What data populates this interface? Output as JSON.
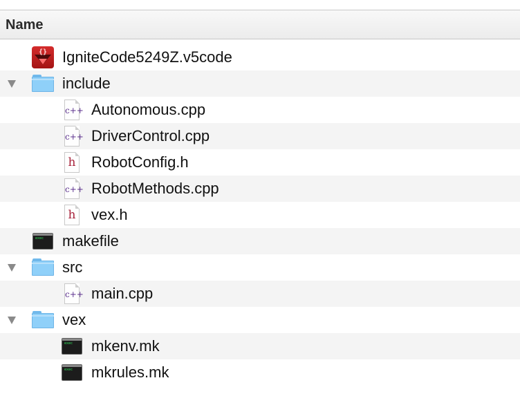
{
  "column_header": {
    "name_label": "Name"
  },
  "rows": [
    {
      "name": "IgniteCode5249Z.v5code",
      "icon": "v5code-file-icon"
    },
    {
      "name": "include",
      "icon": "folder-icon"
    },
    {
      "name": "Autonomous.cpp",
      "icon": "cpp-file-icon"
    },
    {
      "name": "DriverControl.cpp",
      "icon": "cpp-file-icon"
    },
    {
      "name": "RobotConfig.h",
      "icon": "h-file-icon"
    },
    {
      "name": "RobotMethods.cpp",
      "icon": "cpp-file-icon"
    },
    {
      "name": "vex.h",
      "icon": "h-file-icon"
    },
    {
      "name": "makefile",
      "icon": "terminal-file-icon"
    },
    {
      "name": "src",
      "icon": "folder-icon"
    },
    {
      "name": "main.cpp",
      "icon": "cpp-file-icon"
    },
    {
      "name": "vex",
      "icon": "folder-icon"
    },
    {
      "name": "mkenv.mk",
      "icon": "terminal-file-icon"
    },
    {
      "name": "mkrules.mk",
      "icon": "terminal-file-icon"
    }
  ],
  "glyphs": {
    "cpp": "c++",
    "h": "h",
    "exec": "exec",
    "braces": "{}"
  },
  "colors": {
    "folder": "#8fd0f9",
    "v5code": "#c41f1f",
    "alt_row": "#f4f4f4",
    "cpp_glyph": "#5a2e8c",
    "h_glyph": "#a8223b"
  }
}
